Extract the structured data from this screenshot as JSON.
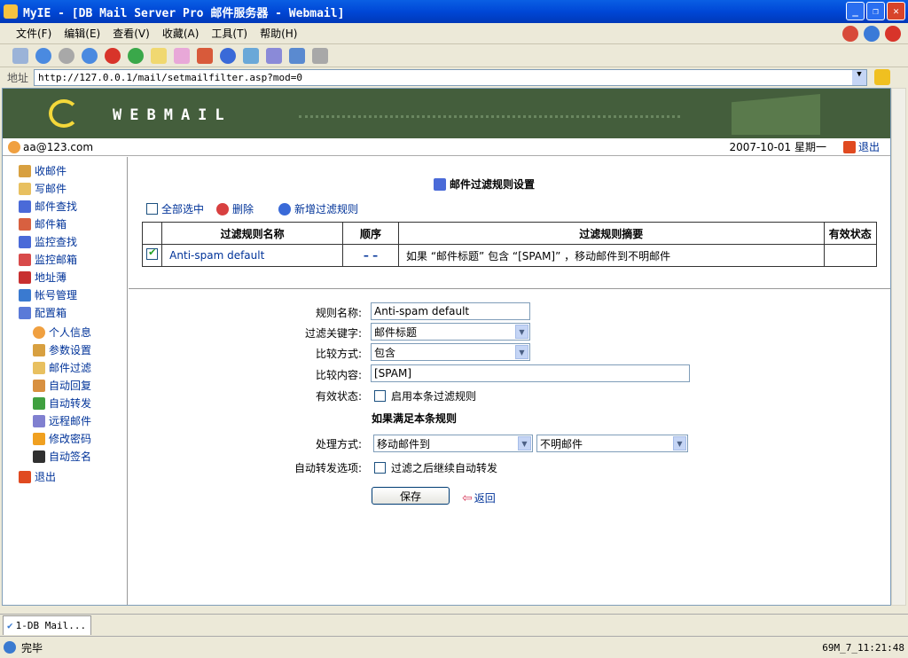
{
  "window": {
    "title": "MyIE - [DB Mail Server Pro 邮件服务器 - Webmail]"
  },
  "menu": [
    "文件(F)",
    "编辑(E)",
    "查看(V)",
    "收藏(A)",
    "工具(T)",
    "帮助(H)"
  ],
  "address": {
    "label": "地址",
    "url": "http://127.0.0.1/mail/setmailfilter.asp?mod=0"
  },
  "banner": {
    "brand": "WEBMAIL"
  },
  "userbar": {
    "user": "aa@123.com",
    "date": "2007-10-01 星期一",
    "logout": "退出"
  },
  "sidebar": {
    "items": [
      "收邮件",
      "写邮件",
      "邮件查找",
      "邮件箱",
      "监控查找",
      "监控邮箱",
      "地址薄",
      "帐号管理",
      "配置箱"
    ],
    "sub_items": [
      "个人信息",
      "参数设置",
      "邮件过滤",
      "自动回复",
      "自动转发",
      "远程邮件",
      "修改密码",
      "自动签名"
    ],
    "logout": "退出"
  },
  "form": {
    "title": "邮件过滤规则设置",
    "select_all": "全部选中",
    "delete": "删除",
    "add_rule": "新增过滤规则",
    "table": {
      "headers": [
        "过滤规则名称",
        "顺序",
        "过滤规则摘要",
        "有效状态"
      ],
      "rows": [
        {
          "name": "Anti-spam default",
          "order": "– –",
          "summary": "如果 “邮件标题” 包含 “[SPAM]” ，移动邮件到不明邮件",
          "status": ""
        }
      ]
    },
    "rule_name_label": "规则名称:",
    "rule_name_value": "Anti-spam default",
    "keyword_label": "过滤关键字:",
    "keyword_value": "邮件标题",
    "compare_label": "比较方式:",
    "compare_value": "包含",
    "content_label": "比较内容:",
    "content_value": "[SPAM]",
    "status_label": "有效状态:",
    "status_checkbox": "启用本条过滤规则",
    "condition_heading": "如果满足本条规则",
    "action_label": "处理方式:",
    "action_value": "移动邮件到",
    "action_target": "不明邮件",
    "forward_label": "自动转发选项:",
    "forward_checkbox": "过滤之后继续自动转发",
    "save": "保存",
    "back": "返回"
  },
  "tabs": [
    {
      "label": "1-DB Mail..."
    }
  ],
  "status": {
    "text": "完毕",
    "clock": "69M_7_11:21:48"
  }
}
